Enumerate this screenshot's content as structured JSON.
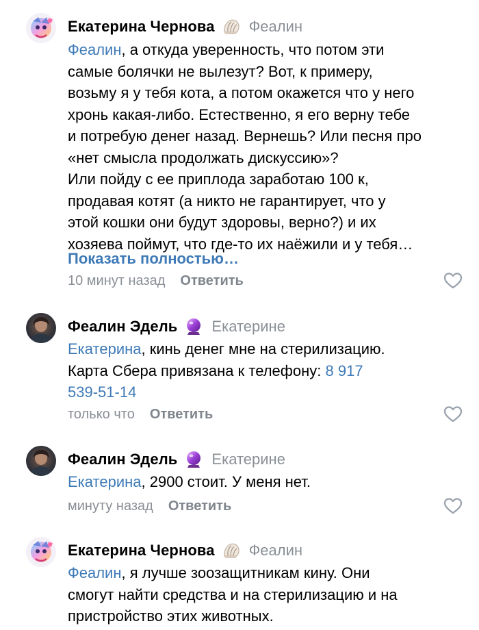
{
  "comments": [
    {
      "author": "Екатерина Чернова",
      "badge_icon": "shell-icon",
      "reply_to": "Феалин",
      "mention": "Феалин",
      "lines": [
        ", а откуда уверенность, что потом эти",
        "самые болячки не вылезут? Вот, к примеру,",
        "возьму я у тебя кота, а потом окажется что у него",
        "хронь какая-либо. Естественно, я его верну тебе",
        "и потребую денег назад. Вернешь? Или песня про",
        "«нет смысла продолжать дискуссию»?",
        "Или пойду с ее приплода заработаю 100 к,",
        "продавая котят (а никто не гарантирует, что у",
        "этой кошки они будут здоровы, верно?) и их",
        "хозяева поймут, что где-то их наёжили и у тебя…"
      ],
      "show_more": "Показать полностью…",
      "time": "10 минут назад",
      "reply_label": "Ответить"
    },
    {
      "author": "Феалин Эдель",
      "badge_icon": "crystal-ball-icon",
      "reply_to": "Екатерине",
      "mention": "Екатерина",
      "line1": ", кинь денег мне на стерилизацию.",
      "line2_text": "Карта Сбера привязана к телефону: ",
      "phone_part1": "8 917",
      "phone_part2": "539-51-14",
      "time": "только что",
      "reply_label": "Ответить"
    },
    {
      "author": "Феалин Эдель",
      "badge_icon": "crystal-ball-icon",
      "reply_to": "Екатерине",
      "mention": "Екатерина",
      "line1": ", 2900 стоит. У меня нет.",
      "time": "минуту назад",
      "reply_label": "Ответить"
    },
    {
      "author": "Екатерина Чернова",
      "badge_icon": "shell-icon",
      "reply_to": "Феалин",
      "mention": "Феалин",
      "lines": [
        ", я лучше зоозащитникам кину. Они",
        "смогут найти средства и на стерилизацию и на",
        "пристройство этих животных."
      ]
    }
  ],
  "colors": {
    "link": "#3e7ab7",
    "secondary_text": "#8a8f96",
    "reply_button": "#7f858c",
    "like_outline": "#99a2ad"
  }
}
